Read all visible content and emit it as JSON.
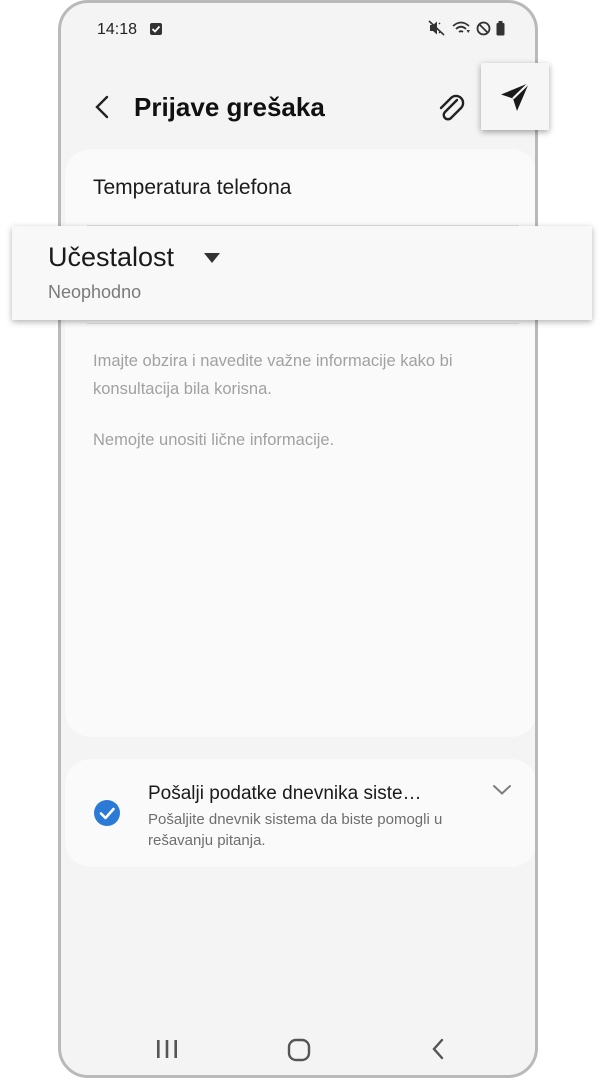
{
  "status": {
    "time": "14:18",
    "icons": [
      "check-box-icon",
      "mute-icon",
      "wifi-icon",
      "no-disturb-icon",
      "battery-icon"
    ]
  },
  "header": {
    "title": "Prijave grešaka",
    "icons": [
      "back-arrow-icon",
      "paperclip-icon",
      "send-icon"
    ]
  },
  "form": {
    "subject_value": "Temperatura telefona",
    "frequency_label": "Učestalost",
    "frequency_required": "Neophodno",
    "hint_line1": "Imajte obzira i navedite važne informacije kako bi konsultacija bila korisna.",
    "hint_line2": "Nemojte unositi lične informacije."
  },
  "log": {
    "checked": true,
    "title": "Pošalji podatke dnevnika siste…",
    "description": "Pošaljite dnevnik sistema da biste pomogli u rešavanju pitanja."
  },
  "navbar": {
    "icons": [
      "recents-icon",
      "home-icon",
      "back-icon"
    ]
  },
  "colors": {
    "accent": "#2a7ad6",
    "background": "#f4f4f4",
    "card": "#fafafa",
    "hint_text": "#a1a1a1"
  }
}
